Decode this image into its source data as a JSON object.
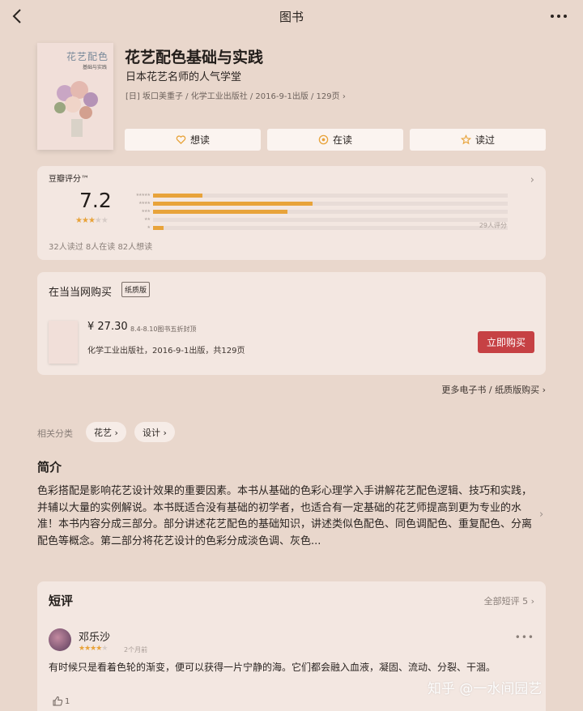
{
  "header": {
    "title": "图书"
  },
  "cover": {
    "title": "花艺配色",
    "subtitle": "基础与实践"
  },
  "book": {
    "title": "花艺配色基础与实践",
    "subtitle": "日本花艺名师的人气学堂",
    "meta": "[日] 坂口美重子 / 化学工业出版社 / 2016-9-1出版 / 129页 ›"
  },
  "actions": {
    "want": "想读",
    "reading": "在读",
    "read": "读过"
  },
  "rating": {
    "label": "豆瓣评分™",
    "score": "7.2",
    "star_value": 3.5,
    "distribution": [
      0.14,
      0.45,
      0.38,
      0.0,
      0.03
    ],
    "count": "29人评分",
    "stats": "32人读过   8人在读   82人想读"
  },
  "buy": {
    "title": "在当当网购买",
    "badge": "纸质版",
    "price": "¥ 27.30",
    "promo": "8.4-8.10图书五折封顶",
    "info": "化学工业出版社，2016-9-1出版，共129页",
    "button": "立即购买"
  },
  "more_buy": "更多电子书 / 纸质版购买 ›",
  "categories": {
    "label": "相关分类",
    "tags": [
      "花艺 ›",
      "设计 ›"
    ]
  },
  "intro": {
    "heading": "简介",
    "text": "色彩搭配是影响花艺设计效果的重要因素。本书从基础的色彩心理学入手讲解花艺配色逻辑、技巧和实践，并辅以大量的实例解说。本书既适合没有基础的初学者，也适合有一定基础的花艺师提高到更为专业的水准！本书内容分成三部分。部分讲述花艺配色的基础知识，讲述类似色配色、同色调配色、重复配色、分离配色等概念。第二部分将花艺设计的色彩分成淡色调、灰色..."
  },
  "reviews": {
    "heading": "短评",
    "all": "全部短评 5 ›",
    "items": [
      {
        "user": "邓乐沙",
        "star_value": 4,
        "time": "2个月前",
        "text": "有时候只是看着色轮的渐变，便可以获得一片宁静的海。它们都会融入血液，凝固、流动、分裂、干涸。",
        "likes": "1"
      }
    ]
  },
  "watermark": "知乎 @一水间园艺"
}
